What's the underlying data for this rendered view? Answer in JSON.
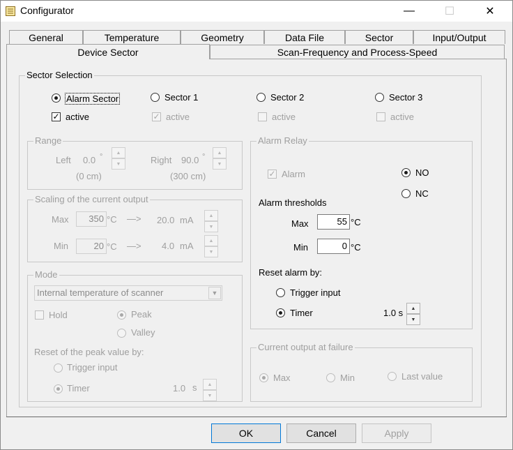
{
  "window": {
    "title": "Configurator",
    "minimize_glyph": "—",
    "maximize_glyph": "☐",
    "close_glyph": "✕"
  },
  "tabs_row1": [
    "General",
    "Temperature",
    "Geometry",
    "Data File",
    "Sector",
    "Input/Output"
  ],
  "tabs_row2": [
    "Device Sector",
    "Scan-Frequency and Process-Speed"
  ],
  "sector_selection": {
    "title": "Sector Selection",
    "sectors": [
      {
        "label": "Alarm Sector",
        "selected": true,
        "active_label": "active",
        "active_checked": true
      },
      {
        "label": "Sector 1",
        "selected": false,
        "active_label": "active",
        "active_checked": true
      },
      {
        "label": "Sector 2",
        "selected": false,
        "active_label": "active",
        "active_checked": false
      },
      {
        "label": "Sector 3",
        "selected": false,
        "active_label": "active",
        "active_checked": false
      }
    ]
  },
  "range": {
    "title": "Range",
    "left_label": "Left",
    "left_value": "0.0",
    "left_unit": "°",
    "left_cm": "(0 cm)",
    "right_label": "Right",
    "right_value": "90.0",
    "right_unit": "°",
    "right_cm": "(300 cm)"
  },
  "scaling": {
    "title": "Scaling of the current output",
    "max_label": "Max",
    "max_value": "350",
    "max_unit": "°C",
    "max_ma": "20.0",
    "min_label": "Min",
    "min_value": "20",
    "min_unit": "°C",
    "min_ma": "4.0",
    "ma_unit": "mA",
    "arrow": "—>"
  },
  "mode": {
    "title": "Mode",
    "select_value": "Internal temperature of scanner",
    "hold_label": "Hold",
    "peak_label": "Peak",
    "valley_label": "Valley",
    "reset_label": "Reset of the peak value by:",
    "trigger_label": "Trigger input",
    "timer_label": "Timer",
    "timer_value": "1.0",
    "timer_unit": "s"
  },
  "alarm_relay": {
    "title": "Alarm Relay",
    "alarm_label": "Alarm",
    "no_label": "NO",
    "nc_label": "NC",
    "thresholds_label": "Alarm thresholds",
    "max_label": "Max",
    "max_value": "55",
    "min_label": "Min",
    "min_value": "0",
    "unit": "°C",
    "reset_label": "Reset alarm by:",
    "trigger_label": "Trigger input",
    "timer_label": "Timer",
    "timer_value": "1.0 s"
  },
  "failure": {
    "title": "Current output at failure",
    "max_label": "Max",
    "min_label": "Min",
    "last_label": "Last value"
  },
  "buttons": {
    "ok": "OK",
    "cancel": "Cancel",
    "apply": "Apply"
  },
  "colors": {
    "accent": "#0078d7",
    "disabled_text": "#9f9f9f",
    "background": "#f0f0f0"
  }
}
